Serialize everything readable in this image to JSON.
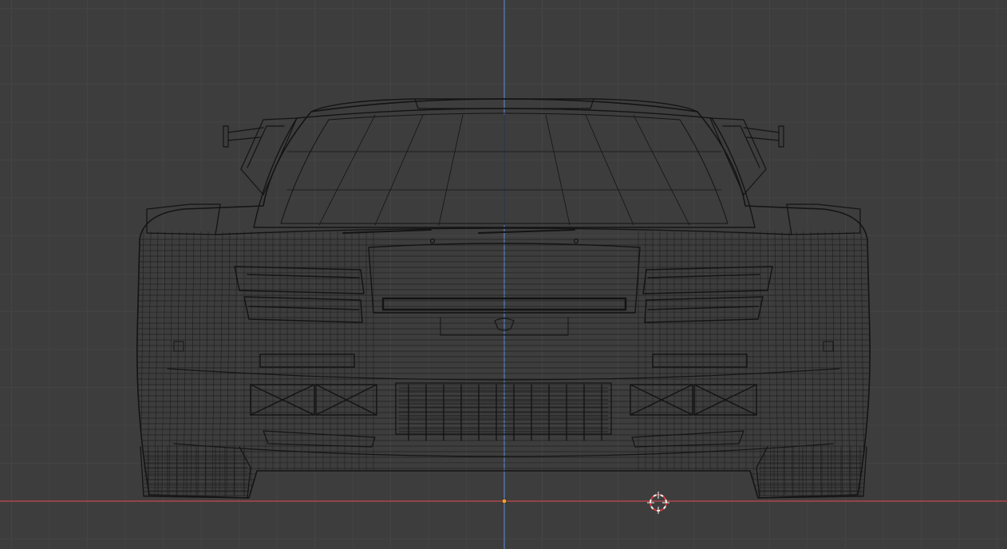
{
  "viewport": {
    "view": "front-orthographic",
    "mode": "wireframe-overlay",
    "grid_visible": true,
    "colors": {
      "background": "#3d3d3d",
      "grid_minor": "#444444",
      "grid_major": "#4a4a4a",
      "axis_x": "#c8494f",
      "axis_z": "#5a7fc4",
      "wire": "#141414",
      "origin": "#f0a030",
      "cursor_red": "#d73b3b",
      "cursor_white": "#f2f2f2"
    }
  },
  "scene": {
    "object": "car-body-mesh",
    "origin_marker": "object-origin-dot",
    "cursor": "3d-cursor-icon"
  }
}
